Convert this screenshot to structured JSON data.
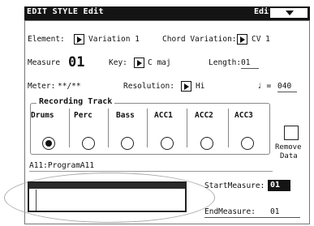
{
  "window": {
    "title": "EDIT STYLE Edit",
    "mode_label": "Edit"
  },
  "fields": {
    "element_label": "Element:",
    "element_value": "Variation 1",
    "chord_variation_label": "Chord Variation:",
    "chord_variation_value": "CV 1",
    "measure_label": "Measure",
    "measure_value": "01",
    "key_label": "Key:",
    "key_value": "C maj",
    "length_label": "Length:",
    "length_value": "01",
    "meter_label": "Meter:",
    "meter_value": "**/**",
    "resolution_label": "Resolution:",
    "resolution_value": "Hi",
    "tempo_symbol": "♩ =",
    "tempo_value": "040"
  },
  "recording_track": {
    "label": "Recording Track",
    "tracks": [
      {
        "label": "Drums",
        "selected": true
      },
      {
        "label": "Perc",
        "selected": false
      },
      {
        "label": "Bass",
        "selected": false
      },
      {
        "label": "ACC1",
        "selected": false
      },
      {
        "label": "ACC2",
        "selected": false
      },
      {
        "label": "ACC3",
        "selected": false
      }
    ]
  },
  "remove_data": {
    "line1": "Remove",
    "line2": "Data"
  },
  "program": {
    "status": "A11:ProgramA11"
  },
  "measures": {
    "start_label": "StartMeasure:",
    "start_value": "01",
    "end_label": "EndMeasure:",
    "end_value": "01"
  },
  "icons": {
    "menu": "chevron-down-icon",
    "popup": "triangle-right-icon"
  }
}
